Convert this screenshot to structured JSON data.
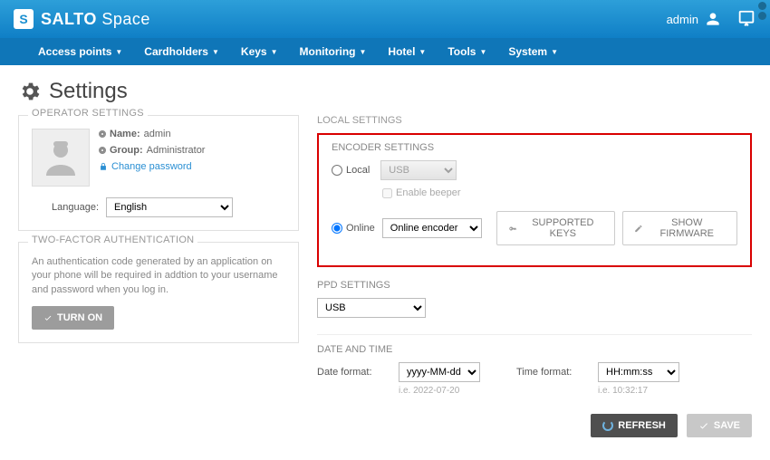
{
  "header": {
    "brand_bold": "SALTO",
    "brand_light": "Space",
    "admin_label": "admin"
  },
  "nav": {
    "items": [
      "Access points",
      "Cardholders",
      "Keys",
      "Monitoring",
      "Hotel",
      "Tools",
      "System"
    ]
  },
  "page": {
    "title": "Settings"
  },
  "operator": {
    "panel_title": "OPERATOR SETTINGS",
    "name_label": "Name:",
    "name_value": "admin",
    "group_label": "Group:",
    "group_value": "Administrator",
    "change_password": "Change password",
    "language_label": "Language:",
    "language_value": "English"
  },
  "tfa": {
    "panel_title": "TWO-FACTOR AUTHENTICATION",
    "text": "An authentication code generated by an application on your phone will be required in addtion to your username and password when you log in.",
    "button": "TURN ON"
  },
  "local": {
    "panel_title": "LOCAL SETTINGS"
  },
  "encoder": {
    "heading": "ENCODER SETTINGS",
    "local_label": "Local",
    "local_select": "USB",
    "enable_beeper": "Enable beeper",
    "online_label": "Online",
    "online_select": "Online encoder",
    "supported_keys": "SUPPORTED KEYS",
    "show_firmware": "SHOW FIRMWARE"
  },
  "ppd": {
    "heading": "PPD SETTINGS",
    "select": "USB"
  },
  "datetime": {
    "heading": "DATE AND TIME",
    "date_label": "Date format:",
    "date_value": "yyyy-MM-dd",
    "date_example_prefix": "i.e.",
    "date_example": "2022-07-20",
    "time_label": "Time format:",
    "time_value": "HH:mm:ss",
    "time_example_prefix": "i.e.",
    "time_example": "10:32:17"
  },
  "footer": {
    "refresh": "REFRESH",
    "save": "SAVE"
  }
}
